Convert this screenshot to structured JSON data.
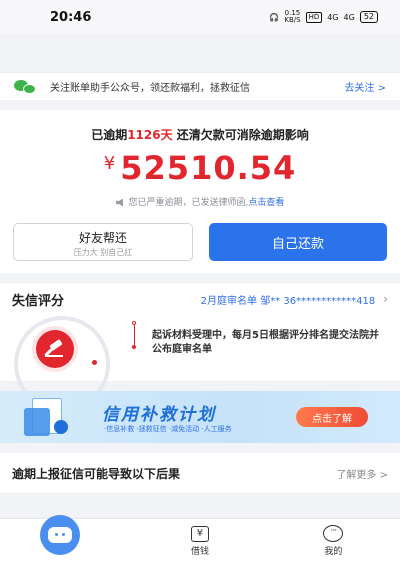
{
  "status": {
    "time": "20:46",
    "speed": "0.15",
    "speed_unit": "KB/S",
    "hd": "HD",
    "net1": "4G",
    "net2": "4G",
    "battery": "52"
  },
  "notice": {
    "text": "关注账单助手公众号，领还款福利，拯救征信",
    "link": "去关注 >"
  },
  "debt": {
    "overdue_prefix": "已逾期",
    "overdue_days": "1126天",
    "overdue_suffix": " 还清欠款可消除逾期影响",
    "currency": "¥",
    "amount": "52510.54",
    "warning": "您已严重逾期，已发送律师函,",
    "warning_link": "点击查看",
    "friend_button": "好友帮还",
    "friend_sub": "压力大 别自己扛",
    "self_button": "自己还款"
  },
  "credit": {
    "title": "失信评分",
    "court_info": "2月庭审名单 邹** 36************418",
    "description": "起诉材料受理中，每月5日根据评分排名提交法院并公布庭审名单"
  },
  "banner": {
    "title": "信用补救计划",
    "subtitle": "·信息补救 ·拯救征信 ·减免活动 ·人工服务",
    "button": "点击了解"
  },
  "consequence": {
    "title": "逾期上报征信可能导致以下后果",
    "more": "了解更多 >"
  },
  "tabs": [
    {
      "label": ""
    },
    {
      "label": "借钱",
      "icon_text": "¥"
    },
    {
      "label": "我的",
      "icon_text": "···"
    }
  ],
  "colors": {
    "accent_blue": "#2a73ea",
    "alert_red": "#e1262d",
    "wechat_green": "#3db44a"
  }
}
